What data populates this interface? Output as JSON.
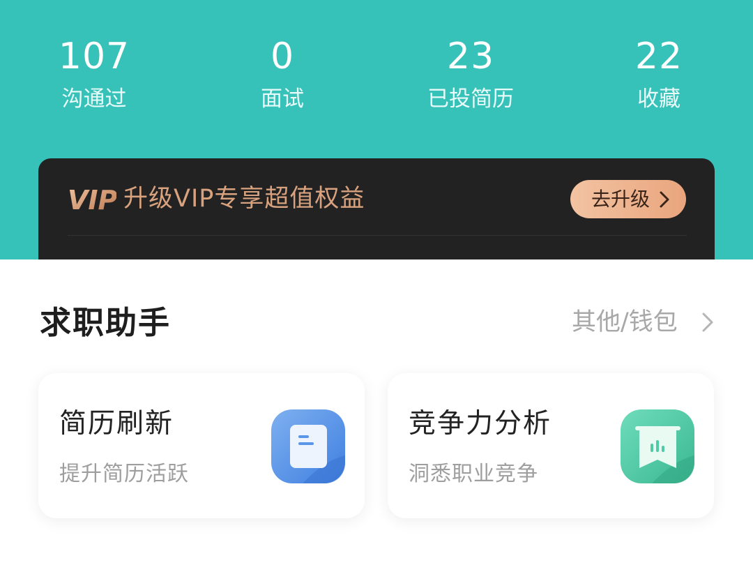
{
  "stats": [
    {
      "value": "107",
      "label": "沟通过"
    },
    {
      "value": "0",
      "label": "面试"
    },
    {
      "value": "23",
      "label": "已投简历"
    },
    {
      "value": "22",
      "label": "收藏"
    }
  ],
  "vip": {
    "logo_text": "VIP",
    "banner_text": "升级VIP专享超值权益",
    "button_label": "去升级",
    "accent_color": "#d9a27e"
  },
  "assistant": {
    "title": "求职助手",
    "more_label": "其他/钱包",
    "tools": [
      {
        "title": "简历刷新",
        "subtitle": "提升简历活跃",
        "icon": "resume-icon",
        "color": "#5b96e8"
      },
      {
        "title": "竞争力分析",
        "subtitle": "洞悉职业竞争",
        "icon": "bar-chart-icon",
        "color": "#4fcba5"
      }
    ]
  },
  "theme": {
    "header_color": "#36c1b9"
  }
}
